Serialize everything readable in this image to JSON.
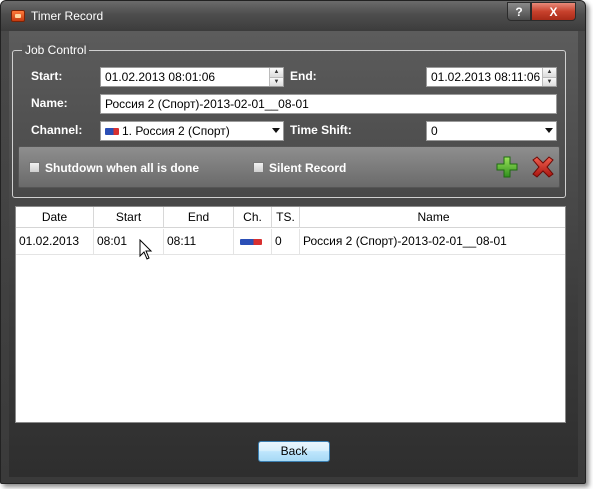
{
  "window": {
    "title": "Timer Record",
    "help_label": "?",
    "close_label": "X"
  },
  "job_control": {
    "legend": "Job Control",
    "start_label": "Start:",
    "start_value": "01.02.2013 08:01:06",
    "end_label": "End:",
    "end_value": "01.02.2013 08:11:06",
    "name_label": "Name:",
    "name_value": "Россия 2 (Спорт)-2013-02-01__08-01",
    "channel_label": "Channel:",
    "channel_value": "1. Россия 2 (Спорт)",
    "time_shift_label": "Time Shift:",
    "time_shift_value": "0",
    "shutdown_label": "Shutdown when all is done",
    "silent_label": "Silent Record"
  },
  "table": {
    "columns": [
      "Date",
      "Start",
      "End",
      "Ch.",
      "TS.",
      "Name"
    ],
    "rows": [
      {
        "date": "01.02.2013",
        "start": "08:01",
        "end": "08:11",
        "ch": "",
        "ts": "0",
        "name": "Россия 2 (Спорт)-2013-02-01__08-01"
      }
    ]
  },
  "footer": {
    "back_label": "Back"
  },
  "colors": {
    "accent_add": "#3aa52a",
    "accent_delete": "#c8201c"
  }
}
